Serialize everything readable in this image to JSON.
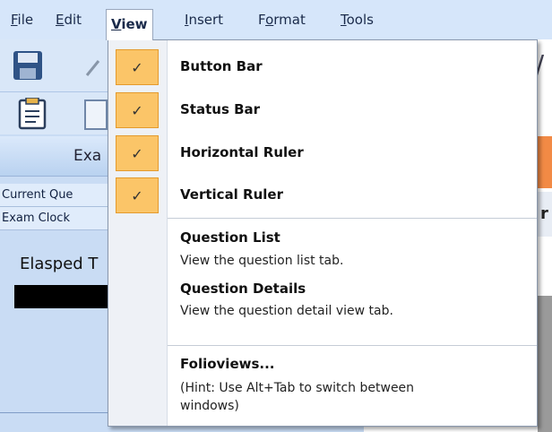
{
  "menubar": {
    "items": [
      {
        "prefix": "",
        "accel": "F",
        "suffix": "ile"
      },
      {
        "prefix": "",
        "accel": "E",
        "suffix": "dit"
      },
      {
        "prefix": "",
        "accel": "V",
        "suffix": "iew"
      },
      {
        "prefix": "",
        "accel": "I",
        "suffix": "nsert"
      },
      {
        "prefix": "F",
        "accel": "o",
        "suffix": "rmat"
      },
      {
        "prefix": "",
        "accel": "T",
        "suffix": "ools"
      }
    ]
  },
  "background": {
    "exam_tab_label": "Exa",
    "current_question_label": "Current Que",
    "exam_clock_label": "Exam Clock",
    "elapsed_label": "Elasped T",
    "right_letter": "r"
  },
  "view_menu": {
    "checked_items": [
      {
        "label": "Button Bar",
        "checked": true
      },
      {
        "label": "Status Bar",
        "checked": true
      },
      {
        "label": "Horizontal Ruler",
        "checked": true
      },
      {
        "label": "Vertical Ruler",
        "checked": true
      }
    ],
    "check_glyph": "✓",
    "question_list": {
      "label": "Question  List",
      "description": "View the question list tab."
    },
    "question_details": {
      "label": "Question  Details",
      "description": "View the question detail view tab."
    },
    "folioviews": {
      "label": "Folioviews...",
      "description": "(Hint: Use Alt+Tab to switch between windows)"
    }
  },
  "colors": {
    "menubar_bg": "#d6e6fa",
    "check_fill": "#fbc568",
    "check_border": "#e49a2d",
    "orange_accent": "#f28a45"
  }
}
